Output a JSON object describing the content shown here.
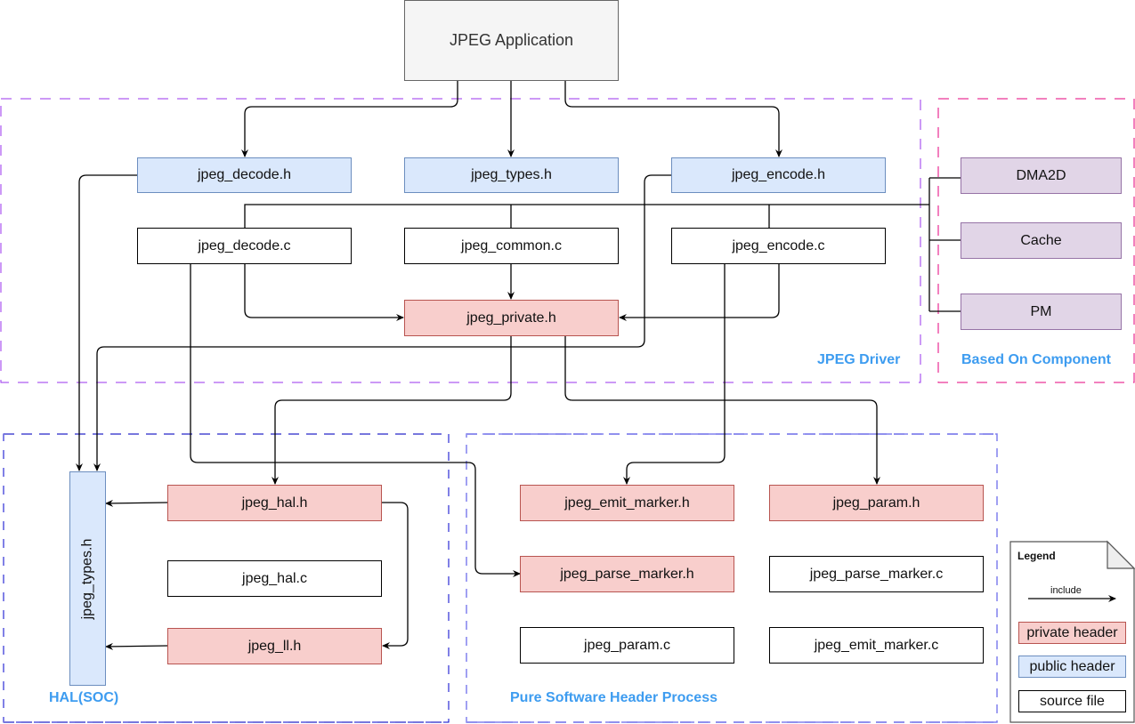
{
  "colors": {
    "private_header_fill": "#f8cecc",
    "private_header_stroke": "#b85450",
    "public_header_fill": "#dae8fc",
    "public_header_stroke": "#6c8ebf",
    "source_fill": "#ffffff",
    "component_fill": "#e1d5e7",
    "component_stroke": "#9673a6",
    "app_fill": "#f5f5f5",
    "group_label": "#3d9cf0",
    "group_driver_border": "#9933ee",
    "group_component_border": "#e6007e",
    "group_hal_border": "#0000cc",
    "group_software_border": "#7777ee"
  },
  "application": {
    "label": "JPEG Application"
  },
  "groups": {
    "driver": "JPEG Driver",
    "component": "Based On Component",
    "hal": "HAL(SOC)",
    "software": "Pure Software Header Process"
  },
  "nodes": {
    "jpeg_decode_h": "jpeg_decode.h",
    "jpeg_types_h_top": "jpeg_types.h",
    "jpeg_encode_h": "jpeg_encode.h",
    "jpeg_decode_c": "jpeg_decode.c",
    "jpeg_common_c": "jpeg_common.c",
    "jpeg_encode_c": "jpeg_encode.c",
    "jpeg_private_h": "jpeg_private.h",
    "dma2d": "DMA2D",
    "cache": "Cache",
    "pm": "PM",
    "jpeg_types_h_hal": "jpeg_types.h",
    "jpeg_hal_h": "jpeg_hal.h",
    "jpeg_hal_c": "jpeg_hal.c",
    "jpeg_ll_h": "jpeg_ll.h",
    "jpeg_emit_marker_h": "jpeg_emit_marker.h",
    "jpeg_param_h": "jpeg_param.h",
    "jpeg_parse_marker_h": "jpeg_parse_marker.h",
    "jpeg_parse_marker_c": "jpeg_parse_marker.c",
    "jpeg_param_c": "jpeg_param.c",
    "jpeg_emit_marker_c": "jpeg_emit_marker.c"
  },
  "legend": {
    "title": "Legend",
    "include": "include",
    "private_header": "private header",
    "public_header": "public header",
    "source_file": "source file"
  },
  "edges": [
    {
      "from": "JPEG Application",
      "to": "jpeg_decode.h",
      "type": "include"
    },
    {
      "from": "JPEG Application",
      "to": "jpeg_types.h",
      "type": "include"
    },
    {
      "from": "JPEG Application",
      "to": "jpeg_encode.h",
      "type": "include"
    },
    {
      "from": "jpeg_common.c",
      "to": "jpeg_private.h",
      "type": "include"
    },
    {
      "from": "jpeg_decode.c",
      "to": "jpeg_private.h",
      "type": "include"
    },
    {
      "from": "jpeg_encode.c",
      "to": "jpeg_private.h",
      "type": "include"
    },
    {
      "from": "jpeg_decode.h",
      "to": "jpeg_types.h (HAL)",
      "type": "include"
    },
    {
      "from": "jpeg_encode.h",
      "to": "jpeg_types.h (HAL)",
      "type": "include"
    },
    {
      "from": "jpeg_private.h",
      "to": "jpeg_hal.h",
      "type": "include"
    },
    {
      "from": "jpeg_private.h",
      "to": "jpeg_param.h",
      "type": "include"
    },
    {
      "from": "jpeg_encode.c",
      "to": "jpeg_emit_marker.h",
      "type": "include"
    },
    {
      "from": "jpeg_decode.c",
      "to": "jpeg_parse_marker.h",
      "type": "include"
    },
    {
      "from": "jpeg_hal.h",
      "to": "jpeg_types.h (HAL)",
      "type": "include"
    },
    {
      "from": "jpeg_ll.h",
      "to": "jpeg_types.h (HAL)",
      "type": "include"
    },
    {
      "from": "jpeg_hal.h",
      "to": "jpeg_ll.h",
      "type": "include"
    },
    {
      "from": "driver sources",
      "to": "DMA2D / Cache / PM",
      "type": "link"
    }
  ]
}
